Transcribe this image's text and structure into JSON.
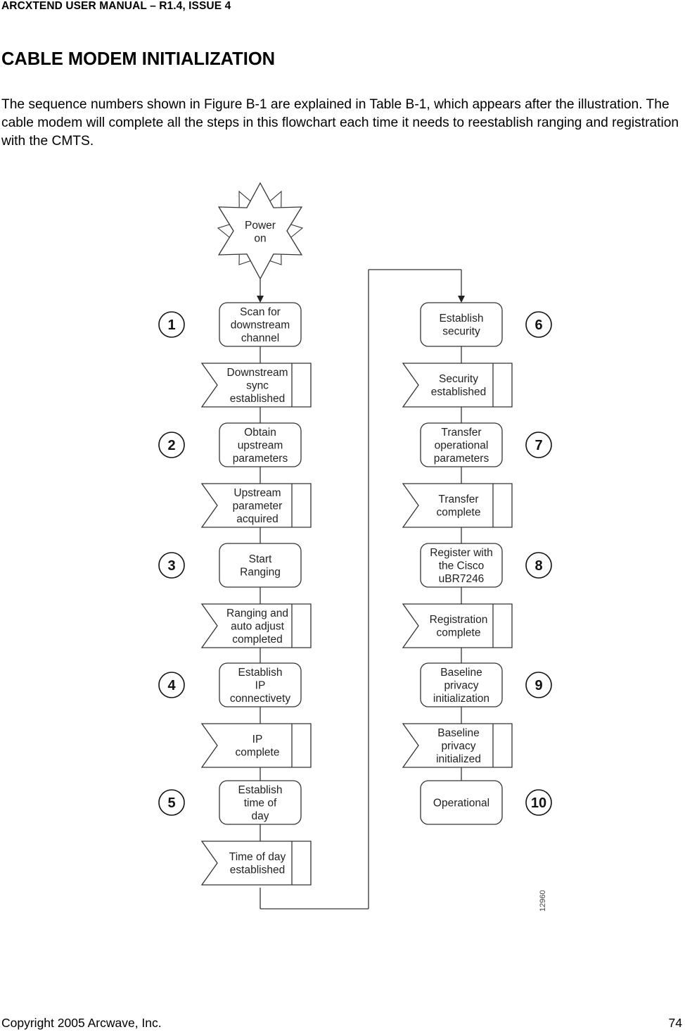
{
  "header": {
    "running_title": "ARCXTEND USER MANUAL – R1.4, ISSUE 4"
  },
  "section": {
    "title": "CABLE MODEM INITIALIZATION",
    "intro": "The sequence numbers shown in Figure B-1 are explained in Table B-1, which appears after the illustration. The cable modem will complete all the steps in this flowchart each time it needs to reestablish ranging and registration with the CMTS."
  },
  "figure": {
    "start": {
      "label": [
        "Power",
        "on"
      ]
    },
    "figure_id": "12960",
    "left_column": [
      {
        "step": "1",
        "process": [
          "Scan for",
          "downstream",
          "channel"
        ],
        "event": [
          "Downstream",
          "sync",
          "established"
        ]
      },
      {
        "step": "2",
        "process": [
          "Obtain",
          "upstream",
          "parameters"
        ],
        "event": [
          "Upstream",
          "parameter",
          "acquired"
        ]
      },
      {
        "step": "3",
        "process": [
          "Start",
          "Ranging"
        ],
        "event": [
          "Ranging and",
          "auto adjust",
          "completed"
        ]
      },
      {
        "step": "4",
        "process": [
          "Establish",
          "IP",
          "connectivety"
        ],
        "event": [
          "IP",
          "complete"
        ]
      },
      {
        "step": "5",
        "process": [
          "Establish",
          "time of",
          "day"
        ],
        "event": [
          "Time of day",
          "established"
        ]
      }
    ],
    "right_column": [
      {
        "step": "6",
        "process": [
          "Establish",
          "security"
        ],
        "event": [
          "Security",
          "established"
        ]
      },
      {
        "step": "7",
        "process": [
          "Transfer",
          "operational",
          "parameters"
        ],
        "event": [
          "Transfer",
          "complete"
        ]
      },
      {
        "step": "8",
        "process": [
          "Register with",
          "the Cisco",
          "uBR7246"
        ],
        "event": [
          "Registration",
          "complete"
        ]
      },
      {
        "step": "9",
        "process": [
          "Baseline",
          "privacy",
          "initialization"
        ],
        "event": [
          "Baseline",
          "privacy",
          "initialized"
        ]
      },
      {
        "step": "10",
        "process": [
          "Operational"
        ],
        "event": null
      }
    ]
  },
  "footer": {
    "copyright": "Copyright 2005 Arcwave, Inc.",
    "page_number": "74"
  }
}
